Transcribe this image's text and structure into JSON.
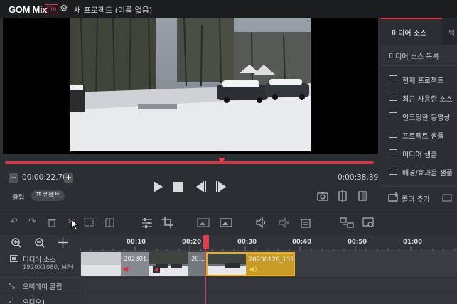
{
  "app": {
    "logo": "GOM Mix",
    "edition": "Pro",
    "project_title": "새 프로젝트 (이름 없음)"
  },
  "player": {
    "current_time": "00:00:22.70",
    "total_time": "0:00:38.89",
    "seek_progress": 0.58,
    "tabs": [
      {
        "label": "클립"
      },
      {
        "label": "프로젝트"
      }
    ]
  },
  "sidepanel": {
    "tabs": [
      {
        "label": "미디어 소스"
      },
      {
        "label": "텍"
      }
    ],
    "header": "미디어 소스 목록",
    "items": [
      {
        "label": "현재 프로젝트",
        "icon": "folder-open-icon"
      },
      {
        "label": "최근 사용한 소스",
        "icon": "folder-icon"
      },
      {
        "label": "인코딩한 동영상",
        "icon": "folder-encode-icon"
      },
      {
        "label": "프로젝트 샘플",
        "icon": "folder-icon"
      },
      {
        "label": "미디어 샘플",
        "icon": "folder-icon"
      },
      {
        "label": "배경/효과음 샘플",
        "icon": "folder-icon"
      }
    ],
    "add_folder": "폴더 추가"
  },
  "timeline": {
    "ruler_ticks": [
      "00:10",
      "00:20",
      "00:30",
      "00:40",
      "00:50",
      "01:00"
    ],
    "tracks": [
      {
        "label": "미디어 소스",
        "info": "1920X1080, MP4"
      },
      {
        "label": "오버레이 클립"
      },
      {
        "label": "오디오1"
      }
    ],
    "clips": [
      {
        "label": ""
      },
      {
        "label": "202301..."
      },
      {
        "label": "20..."
      },
      {
        "label": "20230126_131..."
      }
    ]
  },
  "colors": {
    "accent": "#d63545",
    "selected_clip_border": "#e8b020",
    "audio_icon": "#e8c23a",
    "audio_icon_red": "#d63545"
  }
}
